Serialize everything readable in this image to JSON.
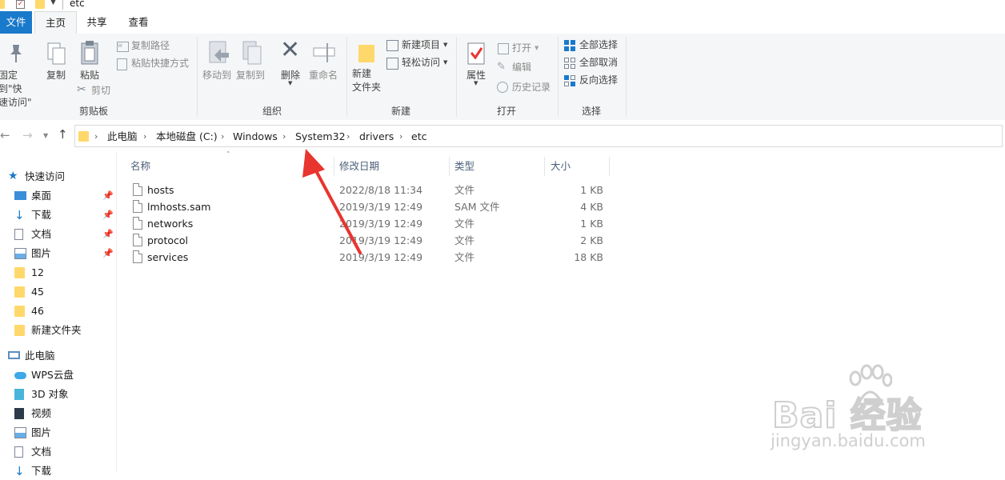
{
  "window": {
    "title": "etc"
  },
  "tabs": {
    "file": "文件",
    "home": "主页",
    "share": "共享",
    "view": "查看"
  },
  "ribbon": {
    "clipboard": {
      "label": "剪贴板",
      "pin_line1": "固定到\"快",
      "pin_line2": "速访问\"",
      "copy": "复制",
      "paste": "粘贴",
      "cut": "剪切",
      "copy_path": "复制路径",
      "paste_shortcut": "粘贴快捷方式"
    },
    "organize": {
      "label": "组织",
      "move_to": "移动到",
      "copy_to": "复制到",
      "delete": "删除",
      "rename": "重命名"
    },
    "new": {
      "label": "新建",
      "new_folder_line1": "新建",
      "new_folder_line2": "文件夹",
      "new_item": "新建项目",
      "easy_access": "轻松访问"
    },
    "open": {
      "label": "打开",
      "properties": "属性",
      "open": "打开",
      "edit": "编辑",
      "history": "历史记录"
    },
    "select": {
      "label": "选择",
      "select_all": "全部选择",
      "select_none": "全部取消",
      "invert": "反向选择"
    }
  },
  "address": {
    "crumbs": [
      "此电脑",
      "本地磁盘 (C:)",
      "Windows",
      "System32",
      "drivers",
      "etc"
    ]
  },
  "sidebar": {
    "items": [
      {
        "label": "快速访问",
        "icon": "star-icon"
      },
      {
        "label": "桌面",
        "icon": "desktop-icon",
        "pinned": true
      },
      {
        "label": "下载",
        "icon": "download-icon",
        "pinned": true
      },
      {
        "label": "文档",
        "icon": "document-icon",
        "pinned": true
      },
      {
        "label": "图片",
        "icon": "pictures-icon",
        "pinned": true
      },
      {
        "label": "12",
        "icon": "folder-icon"
      },
      {
        "label": "45",
        "icon": "folder-icon"
      },
      {
        "label": "46",
        "icon": "folder-icon"
      },
      {
        "label": "新建文件夹",
        "icon": "folder-icon"
      },
      {
        "label": "此电脑",
        "icon": "computer-icon"
      },
      {
        "label": "WPS云盘",
        "icon": "cloud-icon"
      },
      {
        "label": "3D 对象",
        "icon": "cube-icon"
      },
      {
        "label": "视频",
        "icon": "video-icon"
      },
      {
        "label": "图片",
        "icon": "pictures-icon"
      },
      {
        "label": "文档",
        "icon": "document-icon"
      },
      {
        "label": "下载",
        "icon": "download-icon"
      }
    ]
  },
  "columns": {
    "name": "名称",
    "date": "修改日期",
    "type": "类型",
    "size": "大小"
  },
  "files": [
    {
      "name": "hosts",
      "date": "2022/8/18 11:34",
      "type": "文件",
      "size": "1 KB"
    },
    {
      "name": "lmhosts.sam",
      "date": "2019/3/19 12:49",
      "type": "SAM 文件",
      "size": "4 KB"
    },
    {
      "name": "networks",
      "date": "2019/3/19 12:49",
      "type": "文件",
      "size": "1 KB"
    },
    {
      "name": "protocol",
      "date": "2019/3/19 12:49",
      "type": "文件",
      "size": "2 KB"
    },
    {
      "name": "services",
      "date": "2019/3/19 12:49",
      "type": "文件",
      "size": "18 KB"
    }
  ],
  "watermark": {
    "brand": "Bai 经验",
    "url": "jingyan.baidu.com"
  },
  "colors": {
    "accent": "#1979ca",
    "arrow": "#e8352f",
    "folder": "#ffd86b"
  }
}
